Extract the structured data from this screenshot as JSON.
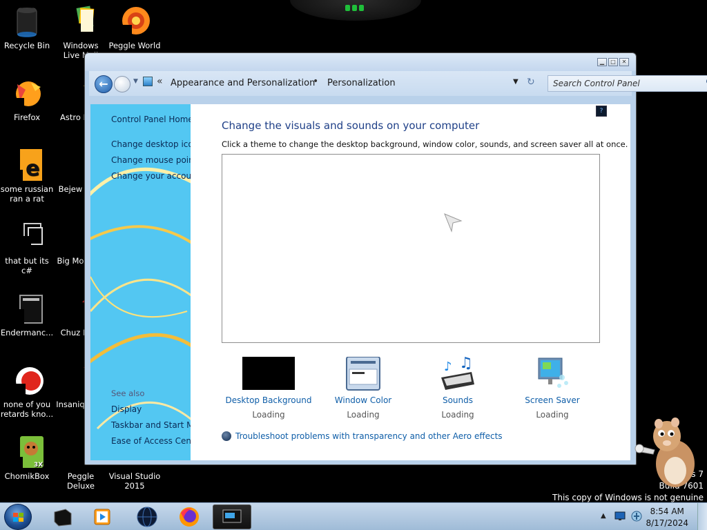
{
  "desktop": {
    "icons": [
      {
        "label": "Recycle Bin"
      },
      {
        "label": "Windows Live Mail"
      },
      {
        "label": "Peggle World"
      },
      {
        "label": "Firefox"
      },
      {
        "label": "Astro Delu"
      },
      {
        "label": "some russian ran a rat"
      },
      {
        "label": "Bejew Delu"
      },
      {
        "label": "that but its c#"
      },
      {
        "label": "Big Mo Delu"
      },
      {
        "label": "Endermanc..."
      },
      {
        "label": "Chuz Delu"
      },
      {
        "label": "none of you retards kno..."
      },
      {
        "label": "Insaniq Delu"
      },
      {
        "label": "ChomikBox"
      },
      {
        "label": "Peggle Deluxe"
      },
      {
        "label": "Visual Studio 2015"
      }
    ]
  },
  "window": {
    "breadcrumb": [
      "Appearance and Personalization",
      "Personalization"
    ],
    "breadcrumb_sep": "•",
    "search_placeholder": "Search Control Panel",
    "caption_buttons": [
      "minimize",
      "maximize",
      "close"
    ]
  },
  "sidebar": {
    "links": [
      "Control Panel Home",
      "Change desktop icons",
      "Change mouse pointers",
      "Change your account picture"
    ],
    "see_also_title": "See also",
    "see_also": [
      "Display",
      "Taskbar and Start Menu",
      "Ease of Access Center"
    ]
  },
  "main": {
    "title": "Change the visuals and sounds on your computer",
    "subtitle": "Click a theme to change the desktop background, window color, sounds, and screen saver all at once.",
    "tools": [
      {
        "label": "Desktop Background",
        "status": "Loading",
        "icon": "desktop-background-icon"
      },
      {
        "label": "Window Color",
        "status": "Loading",
        "icon": "window-color-icon"
      },
      {
        "label": "Sounds",
        "status": "Loading",
        "icon": "sounds-icon"
      },
      {
        "label": "Screen Saver",
        "status": "Loading",
        "icon": "screen-saver-icon"
      }
    ],
    "troubleshoot": "Troubleshoot problems with transparency and other Aero effects"
  },
  "watermark": {
    "line1": "ws 7",
    "line2": "Build 7601",
    "line3": "This copy of Windows is not genuine"
  },
  "taskbar": {
    "items": [
      "black-box-app",
      "media-player",
      "globe-app",
      "firefox",
      "control-panel-window"
    ],
    "time": "8:54 AM",
    "date": "8/17/2024"
  },
  "colors": {
    "link": "#0f5ea8",
    "title": "#1e3f87",
    "sidebar": "#53c7f2"
  }
}
